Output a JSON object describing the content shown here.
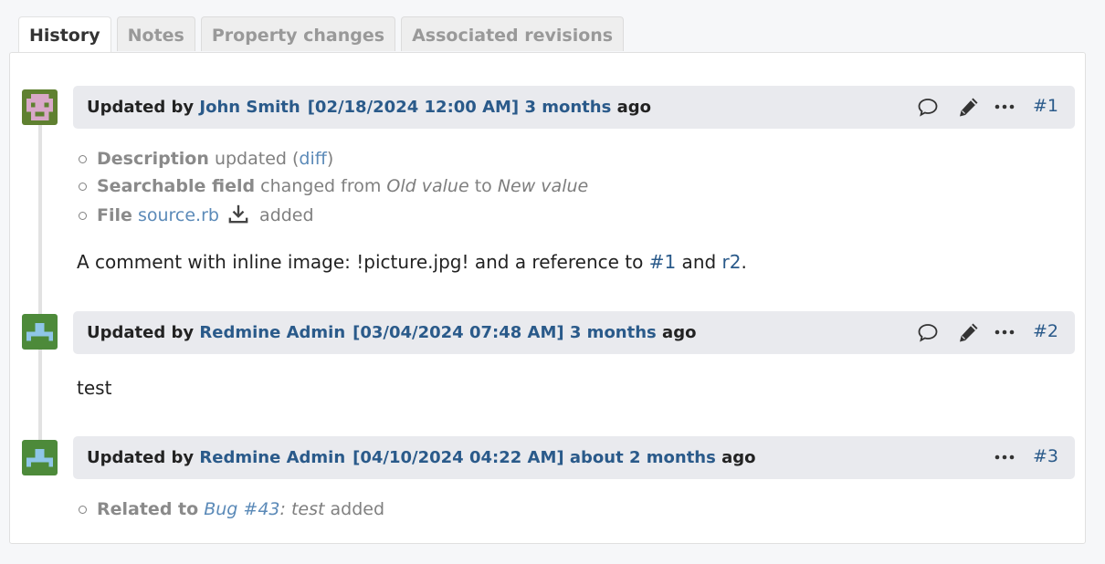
{
  "tabs": [
    "History",
    "Notes",
    "Property changes",
    "Associated revisions"
  ],
  "journals": [
    {
      "prefix": "Updated by",
      "author": "John Smith",
      "date": "[02/18/2024 12:00 AM]",
      "age": "3 months",
      "suffix": "ago",
      "number": "#1",
      "avatar": "pink-invader-avatar",
      "details": {
        "description_name": "Description",
        "description_text": "updated (",
        "description_link": "diff",
        "description_close": ")",
        "field_name": "Searchable field",
        "field_text": "changed from",
        "field_old": "Old value",
        "field_to": "to",
        "field_new": "New value",
        "file_name": "File",
        "file_link": "source.rb",
        "file_text": "added"
      },
      "note": {
        "text": "A comment with inline image: !picture.jpg! and a reference to ",
        "link1": "#1",
        "and": " and ",
        "link2": "r2",
        "end": "."
      }
    },
    {
      "prefix": "Updated by",
      "author": "Redmine Admin",
      "date": "[03/04/2024 07:48 AM]",
      "age": "3 months",
      "suffix": "ago",
      "number": "#2",
      "avatar": "green-admin-avatar",
      "note": {
        "text": "test"
      }
    },
    {
      "prefix": "Updated by",
      "author": "Redmine Admin",
      "date": "[04/10/2024 04:22 AM]",
      "age": "about 2 months",
      "suffix": "ago",
      "number": "#3",
      "avatar": "green-admin-avatar",
      "details": {
        "relation_name": "Related to",
        "relation_link": "Bug #43",
        "relation_subject": ": test",
        "relation_text": "added"
      }
    }
  ],
  "colors": {
    "link": "#2a5a8a",
    "detail_link": "#5b8ab8",
    "header_bg": "#e9eaee"
  }
}
